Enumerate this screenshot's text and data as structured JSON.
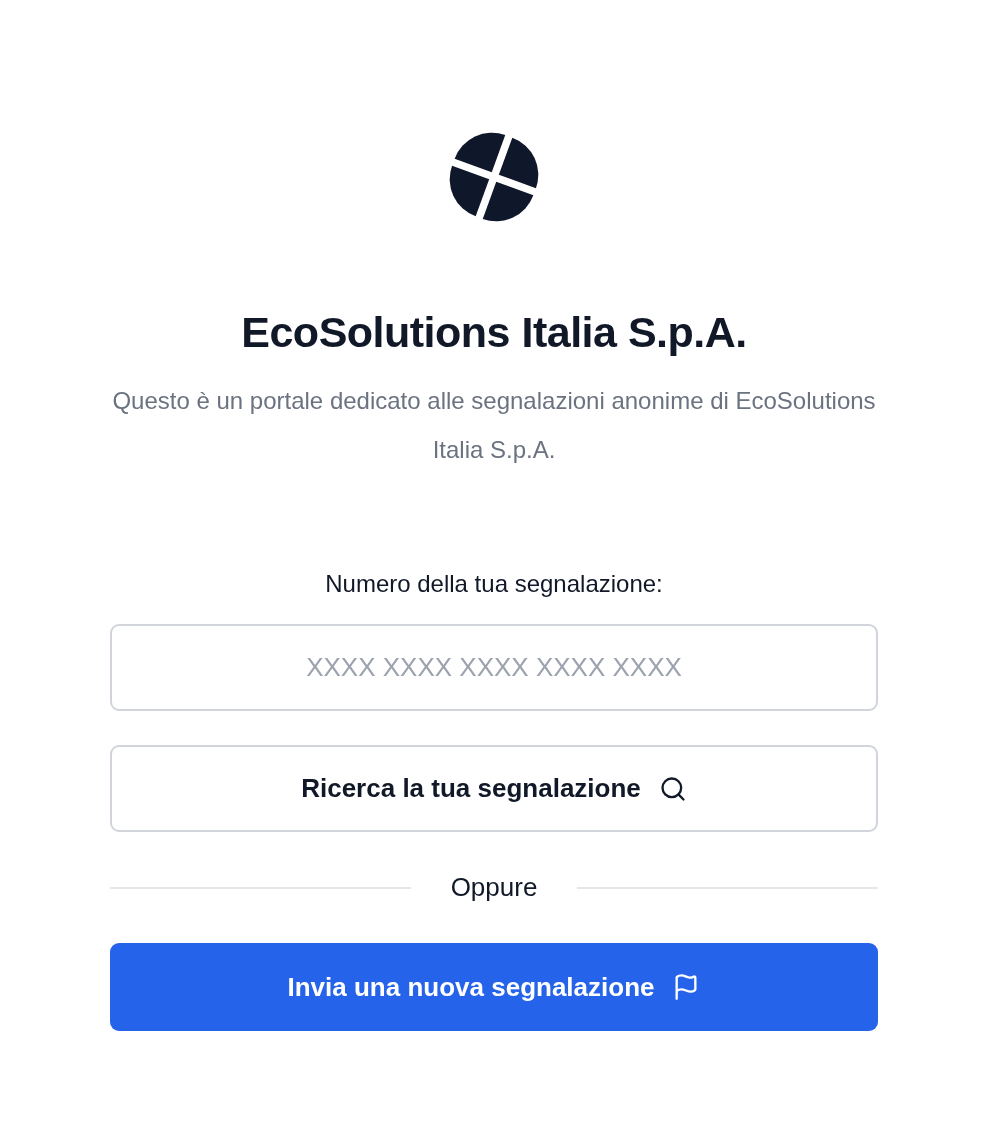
{
  "company": {
    "name": "EcoSolutions Italia S.p.A.",
    "description": "Questo è un portale dedicato alle segnalazioni anonime di EcoSolutions Italia S.p.A."
  },
  "lookup": {
    "label": "Numero della tua segnalazione:",
    "placeholder": "XXXX XXXX XXXX XXXX XXXX",
    "button": "Ricerca la tua segnalazione"
  },
  "separator": "Oppure",
  "new_report": {
    "button": "Invia una nuova segnalazione"
  }
}
